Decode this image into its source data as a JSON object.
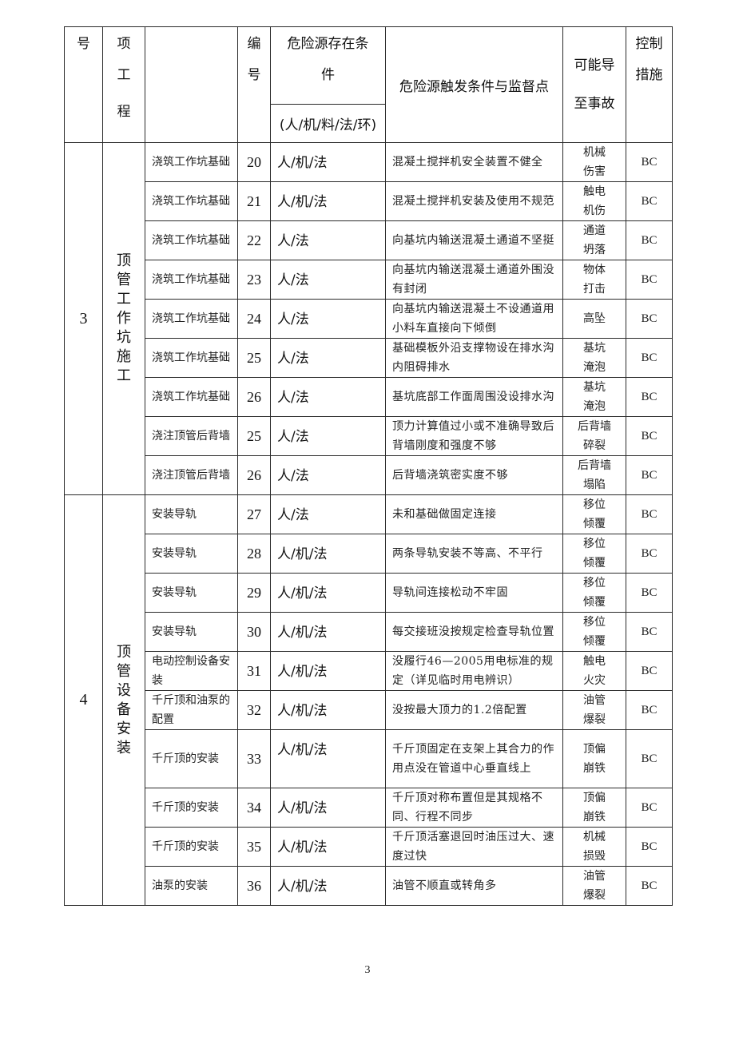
{
  "header": {
    "col_no": "号",
    "col_project": [
      "项",
      "工",
      "程"
    ],
    "col_item": "",
    "col_code": [
      "编",
      "号"
    ],
    "col_condition_title": [
      "危险源存在条",
      "件"
    ],
    "col_condition_sub": "(人/机/料/法/环)",
    "col_trigger": "危险源触发条件与监督点",
    "col_accident": [
      "可能导",
      "至事故"
    ],
    "col_control": [
      "控制",
      "措施"
    ]
  },
  "groups": [
    {
      "no": "3",
      "project": [
        "顶",
        "管",
        "工",
        "作",
        "坑",
        "施",
        "工"
      ],
      "rows": [
        {
          "item": "浇筑工作坑基础",
          "code": "20",
          "condition": "人/机/法",
          "trigger": "混凝土搅拌机安全装置不健全",
          "accident": "机械伤害",
          "control": "BC"
        },
        {
          "item": "浇筑工作坑基础",
          "code": "21",
          "condition": "人/机/法",
          "trigger": "混凝土搅拌机安装及使用不规范",
          "accident": "触电机伤",
          "control": "BC"
        },
        {
          "item": "浇筑工作坑基础",
          "code": "22",
          "condition": "人/法",
          "trigger": "向基坑内输送混凝土通道不坚挺",
          "accident": "通道坍落",
          "control": "BC"
        },
        {
          "item": "浇筑工作坑基础",
          "code": "23",
          "condition": "人/法",
          "trigger": "向基坑内输送混凝土通道外围没有封闭",
          "accident": "物体打击",
          "control": "BC"
        },
        {
          "item": "浇筑工作坑基础",
          "code": "24",
          "condition": "人/法",
          "trigger": "向基坑内输送混凝土不设通道用小料车直接向下倾倒",
          "accident": "高坠",
          "control": "BC"
        },
        {
          "item": "浇筑工作坑基础",
          "code": "25",
          "condition": "人/法",
          "trigger": "基础模板外沿支撑物设在排水沟内阻碍排水",
          "accident": "基坑淹泡",
          "control": "BC"
        },
        {
          "item": "浇筑工作坑基础",
          "code": "26",
          "condition": "人/法",
          "trigger": "基坑底部工作面周围没设排水沟",
          "accident": "基坑淹泡",
          "control": "BC"
        },
        {
          "item": "浇注顶管后背墙",
          "code": "25",
          "condition": "人/法",
          "trigger": "顶力计算值过小或不准确导致后背墙刚度和强度不够",
          "accident": "后背墙碎裂",
          "control": "BC"
        },
        {
          "item": "浇注顶管后背墙",
          "code": "26",
          "condition": "人/法",
          "trigger": "后背墙浇筑密实度不够",
          "accident": "后背墙塌陷",
          "control": "BC"
        }
      ]
    },
    {
      "no": "4",
      "project": [
        "顶",
        "管",
        "设",
        "备",
        "安",
        "装"
      ],
      "rows": [
        {
          "item": "安装导轨",
          "code": "27",
          "condition": "人/法",
          "trigger": "未和基础做固定连接",
          "accident": "移位倾覆",
          "control": "BC"
        },
        {
          "item": "安装导轨",
          "code": "28",
          "condition": "人/机/法",
          "trigger": "两条导轨安装不等高、不平行",
          "accident": "移位倾覆",
          "control": "BC"
        },
        {
          "item": "安装导轨",
          "code": "29",
          "condition": "人/机/法",
          "trigger": "导轨间连接松动不牢固",
          "accident": "移位倾覆",
          "control": "BC"
        },
        {
          "item": "安装导轨",
          "code": "30",
          "condition": "人/机/法",
          "trigger": "每交接班没按规定检查导轨位置",
          "accident": "移位倾覆",
          "control": "BC"
        },
        {
          "item": "电动控制设备安装",
          "code": "31",
          "condition": "人/机/法",
          "trigger": "没履行46—2005用电标准的规定（详见临时用电辨识）",
          "accident": "触电火灾",
          "control": "BC"
        },
        {
          "item": "千斤顶和油泵的配置",
          "code": "32",
          "condition": "人/机/法",
          "trigger": "没按最大顶力的1.2倍配置",
          "accident": "油管爆裂",
          "control": "BC"
        },
        {
          "item": "千斤顶的安装",
          "code": "33",
          "condition": "人/机/法",
          "trigger": "千斤顶固定在支架上其合力的作用点没在管道中心垂直线上",
          "accident": "顶偏崩铁",
          "control": "BC"
        },
        {
          "item": "千斤顶的安装",
          "code": "34",
          "condition": "人/机/法",
          "trigger": "千斤顶对称布置但是其规格不同、行程不同步",
          "accident": "顶偏崩铁",
          "control": "BC"
        },
        {
          "item": "千斤顶的安装",
          "code": "35",
          "condition": "人/机/法",
          "trigger": "千斤顶活塞退回时油压过大、速度过快",
          "accident": "机械损毁",
          "control": "BC"
        },
        {
          "item": "油泵的安装",
          "code": "36",
          "condition": "人/机/法",
          "trigger": "油管不顺直或转角多",
          "accident": "油管爆裂",
          "control": "BC"
        }
      ]
    }
  ],
  "footer": {
    "page_number": "3"
  }
}
